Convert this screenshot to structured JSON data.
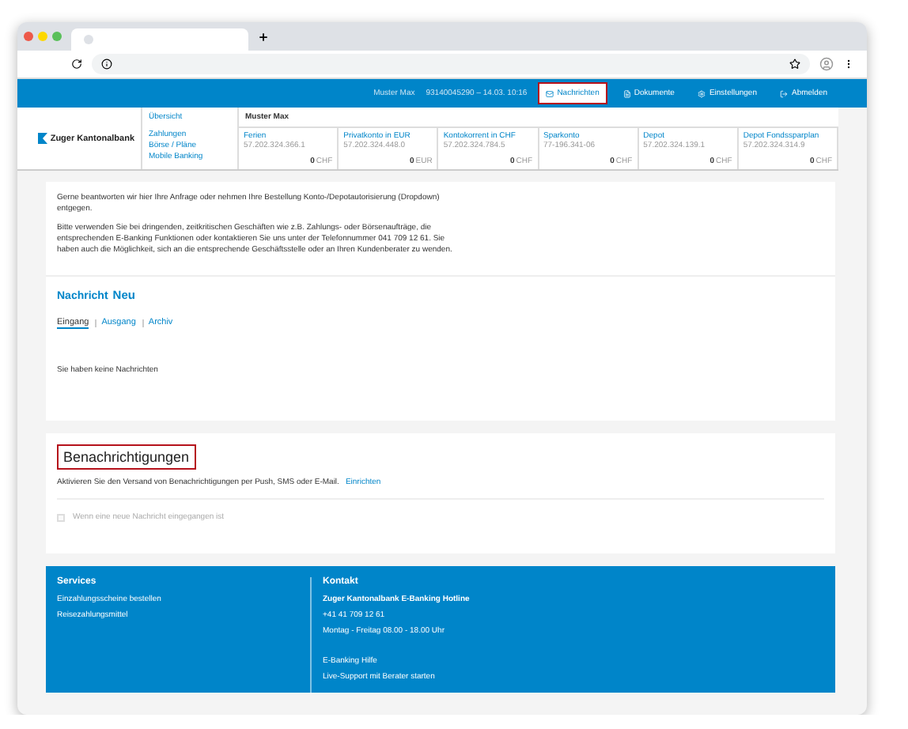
{
  "top_nav": {
    "user": "Muster Max",
    "session": "93140045290 – 14.03. 10:16",
    "items": [
      {
        "kind": "messages",
        "label": "Nachrichten",
        "selected": true,
        "highlighted": true
      },
      {
        "kind": "documents",
        "label": "Dokumente",
        "selected": false,
        "highlighted": false
      },
      {
        "kind": "settings",
        "label": "Einstellungen",
        "selected": false,
        "highlighted": false
      },
      {
        "kind": "logout",
        "label": "Abmelden",
        "selected": false,
        "highlighted": false
      }
    ]
  },
  "header": {
    "logo": "Zuger Kantonalbank",
    "menu": [
      "Übersicht",
      "Zahlungen",
      "Börse / Pläne",
      "Mobile Banking"
    ],
    "account_holder": "Muster Max",
    "accounts": [
      {
        "name": "Ferien",
        "number": "57.202.324.366.1",
        "balance": "0",
        "currency": "CHF"
      },
      {
        "name": "Privatkonto in EUR",
        "number": "57.202.324.448.0",
        "balance": "0",
        "currency": "EUR"
      },
      {
        "name": "Kontokorrent in CHF",
        "number": "57.202.324.784.5",
        "balance": "0",
        "currency": "CHF"
      },
      {
        "name": "Sparkonto",
        "number": "77-196.341-06",
        "balance": "0",
        "currency": "CHF"
      },
      {
        "name": "Depot",
        "number": "57.202.324.139.1",
        "balance": "0",
        "currency": "CHF"
      },
      {
        "name": "Depot Fondssparplan",
        "number": "57.202.324.314.9",
        "balance": "0",
        "currency": "CHF"
      }
    ]
  },
  "messages": {
    "paragraphs": [
      "Gerne beantworten wir hier Ihre Anfrage oder nehmen Ihre Bestellung Konto-/Depotautorisierung (Dropdown) entgegen.",
      "Bitte verwenden Sie bei dringenden, zeitkritischen Geschäften wie z.B. Zahlungs- oder Börsenaufträge, die entsprechenden E-Banking Funktionen oder kontaktieren Sie uns unter der Telefonnummer 041 709 12 61. Sie haben auch die Möglichkeit, sich an die entsprechende Geschäftsstelle oder an Ihren Kundenberater zu wenden."
    ],
    "title": "Nachricht",
    "new_link": "Neu",
    "tabs": [
      {
        "label": "Eingang",
        "selected": true
      },
      {
        "label": "Ausgang",
        "selected": false
      },
      {
        "label": "Archiv",
        "selected": false
      }
    ],
    "empty_text": "Sie haben keine Nachrichten"
  },
  "notifications": {
    "title": "Benachrichtigungen",
    "highlighted": true,
    "text": "Aktivieren Sie den Versand von Benachrichtigungen per Push, SMS oder E-Mail.",
    "link": "Einrichten",
    "option": {
      "label": "Wenn eine neue Nachricht eingegangen ist",
      "checked": false,
      "disabled": true
    }
  },
  "footer": {
    "columns": [
      {
        "title": "Services",
        "lines": [
          {
            "text": "Einzahlungsscheine bestellen",
            "bold": false,
            "gap": false
          },
          {
            "text": "Reisezahlungsmittel",
            "bold": false,
            "gap": false
          }
        ]
      },
      {
        "title": "Kontakt",
        "lines": [
          {
            "text": "Zuger Kantonalbank E-Banking Hotline",
            "bold": true,
            "gap": false
          },
          {
            "text": "+41 41 709 12 61",
            "bold": false,
            "gap": false
          },
          {
            "text": "Montag - Freitag 08.00 - 18.00 Uhr",
            "bold": false,
            "gap": false
          },
          {
            "text": "E-Banking Hilfe",
            "bold": false,
            "gap": true
          },
          {
            "text": "Live-Support mit Berater starten",
            "bold": false,
            "gap": false
          }
        ]
      }
    ]
  }
}
